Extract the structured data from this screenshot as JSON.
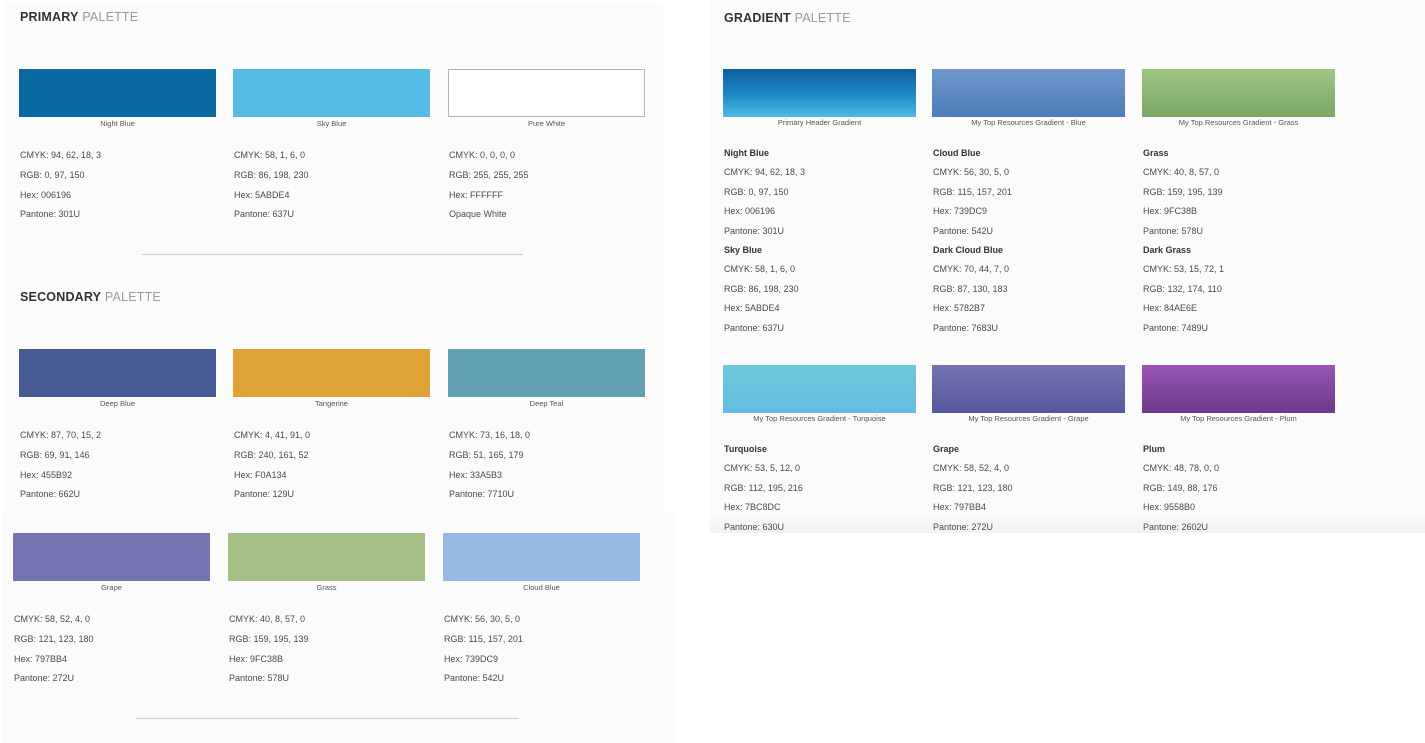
{
  "primary": {
    "title_bold": "PRIMARY",
    "title_light": "PALETTE",
    "swatches": [
      {
        "label": "Night Blue",
        "color": "#006196",
        "cmyk": "CMYK: 94, 62, 18, 3",
        "rgb": "RGB: 0, 97, 150",
        "hex": "Hex: 006196",
        "pantone": "Pantone: 301U"
      },
      {
        "label": "Sky Blue",
        "color": "#5ABDE4",
        "cmyk": "CMYK: 58, 1, 6, 0",
        "rgb": "RGB: 86, 198, 230",
        "hex": "Hex: 5ABDE4",
        "pantone": "Pantone: 637U"
      },
      {
        "label": "Pure White",
        "color": "#FFFFFF",
        "cmyk": "CMYK: 0, 0, 0, 0",
        "rgb": "RGB: 255, 255, 255",
        "hex": "Hex: FFFFFF",
        "pantone": "Opaque White"
      }
    ]
  },
  "secondary": {
    "title_bold": "SECONDARY",
    "title_light": "PALETTE",
    "swatches": [
      {
        "label": "Deep Blue",
        "color": "#455B92",
        "cmyk": "CMYK: 87, 70, 15, 2",
        "rgb": "RGB: 69, 91, 146",
        "hex": "Hex: 455B92",
        "pantone": "Pantone: 662U"
      },
      {
        "label": "Tangerine",
        "color": "#F0A134",
        "cmyk": "CMYK: 4, 41, 91, 0",
        "rgb": "RGB: 240, 161, 52",
        "hex": "Hex: F0A134",
        "pantone": "Pantone: 129U"
      },
      {
        "label": "Deep Teal",
        "color": "#33A5B3",
        "cmyk": "CMYK: 73, 16, 18, 0",
        "rgb": "RGB: 51, 165, 179",
        "hex": "Hex: 33A5B3",
        "pantone": "Pantone: 7710U"
      },
      {
        "label": "Grape",
        "color": "#797BB4",
        "cmyk": "CMYK: 58, 52, 4, 0",
        "rgb": "RGB: 121, 123, 180",
        "hex": "Hex: 797BB4",
        "pantone": "Pantone: 272U"
      },
      {
        "label": "Grass",
        "color": "#9FC38B",
        "cmyk": "CMYK: 40, 8, 57, 0",
        "rgb": "RGB: 159, 195, 139",
        "hex": "Hex: 9FC38B",
        "pantone": "Pantone: 578U"
      },
      {
        "label": "Cloud Blue",
        "color": "#739DC9",
        "cmyk": "CMYK: 56, 30, 5, 0",
        "rgb": "RGB: 115, 157, 201",
        "hex": "Hex: 739DC9",
        "pantone": "Pantone: 542U"
      }
    ]
  },
  "gradient": {
    "title_bold": "GRADIENT",
    "title_light": "PALETTE",
    "swatches": [
      {
        "label": "Primary Header Gradient",
        "from": "#006196",
        "to": "#5ABDE4",
        "c1": {
          "name": "Night Blue",
          "cmyk": "CMYK: 94, 62, 18, 3",
          "rgb": "RGB: 0, 97, 150",
          "hex": "Hex: 006196",
          "pantone": "Pantone: 301U"
        },
        "c2": {
          "name": "Sky Blue",
          "cmyk": "CMYK: 58, 1, 6, 0",
          "rgb": "RGB: 86, 198, 230",
          "hex": "Hex: 5ABDE4",
          "pantone": "Pantone: 637U"
        }
      },
      {
        "label": "My Top Resources Gradient - Blue",
        "from": "#739DC9",
        "to": "#5782B7",
        "c1": {
          "name": "Cloud Blue",
          "cmyk": "CMYK: 56, 30, 5, 0",
          "rgb": "RGB: 115, 157, 201",
          "hex": "Hex: 739DC9",
          "pantone": "Pantone: 542U"
        },
        "c2": {
          "name": "Dark Cloud Blue",
          "cmyk": "CMYK: 70, 44, 7, 0",
          "rgb": "RGB: 87, 130, 183",
          "hex": "Hex: 5782B7",
          "pantone": "Pantone: 7683U"
        }
      },
      {
        "label": "My Top Resources Gradient - Grass",
        "from": "#9FC38B",
        "to": "#84AE6E",
        "c1": {
          "name": "Grass",
          "cmyk": "CMYK: 40, 8, 57, 0",
          "rgb": "RGB: 159, 195, 139",
          "hex": "Hex: 9FC38B",
          "pantone": "Pantone: 578U"
        },
        "c2": {
          "name": "Dark Grass",
          "cmyk": "CMYK: 53, 15, 72, 1",
          "rgb": "RGB: 132, 174, 110",
          "hex": "Hex: 84AE6E",
          "pantone": "Pantone: 7489U"
        }
      },
      {
        "label": "My Top Resources Gradient - Turquoise",
        "from": "#70C3D8",
        "to": "#5ABDE4",
        "c1": {
          "name": "Turquoise",
          "cmyk": "CMYK: 53, 5, 12, 0",
          "rgb": "RGB: 112, 195, 216",
          "hex": "Hex: 7BC8DC",
          "pantone": "Pantone: 630U"
        }
      },
      {
        "label": "My Top Resources Gradient - Grape",
        "from": "#797BB4",
        "to": "#5A5CA0",
        "c1": {
          "name": "Grape",
          "cmyk": "CMYK: 58, 52, 4, 0",
          "rgb": "RGB: 121, 123, 180",
          "hex": "Hex: 797BB4",
          "pantone": "Pantone: 272U"
        }
      },
      {
        "label": "My Top Resources Gradient - Plum",
        "from": "#9558B0",
        "to": "#6E3D8A",
        "c1": {
          "name": "Plum",
          "cmyk": "CMYK: 48, 78, 0, 0",
          "rgb": "RGB: 149, 88, 176",
          "hex": "Hex: 9558B0",
          "pantone": "Pantone: 2602U"
        }
      }
    ]
  }
}
